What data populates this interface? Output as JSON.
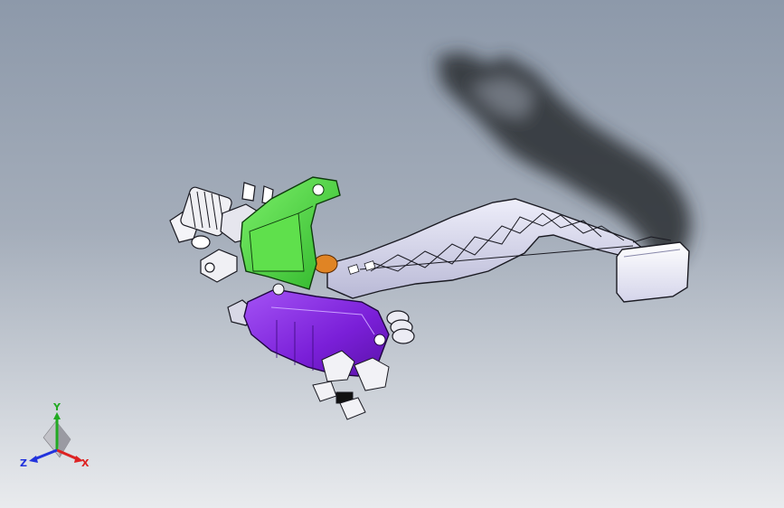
{
  "viewport": {
    "background_top": "#8d99aa",
    "background_bottom": "#e9ebee"
  },
  "model": {
    "parts": [
      {
        "name": "pedal-arm",
        "color": "#dcdcf2"
      },
      {
        "name": "pedal-pad",
        "color": "#ececf8"
      },
      {
        "name": "mounting-bracket",
        "color": "#44d43a"
      },
      {
        "name": "lower-housing",
        "color": "#7a1fd8"
      },
      {
        "name": "spring-assembly",
        "color": "#f0f0f4"
      },
      {
        "name": "pivot-bushing",
        "color": "#e08424"
      }
    ],
    "shadow_color": "#2a2d33"
  },
  "triad": {
    "y_label": "Y",
    "x_label": "X",
    "z_label": "Z",
    "y_color": "#22aa22",
    "x_color": "#dd2222",
    "z_color": "#2233dd"
  }
}
